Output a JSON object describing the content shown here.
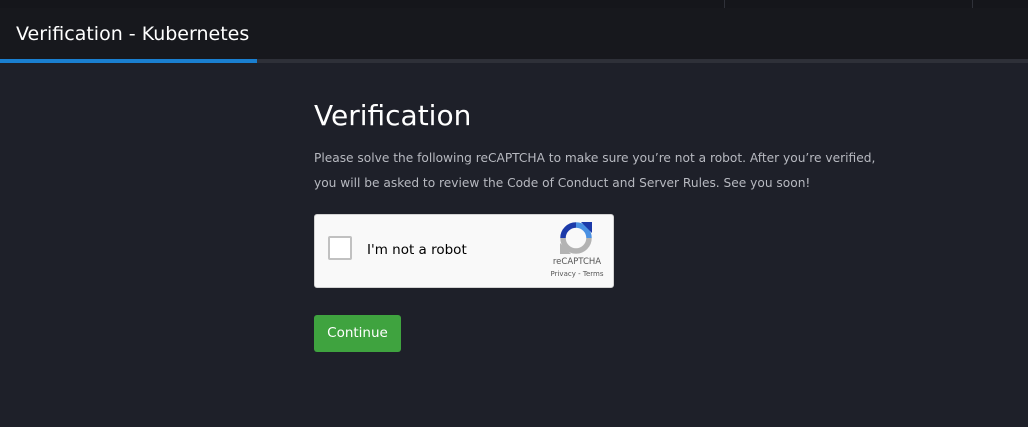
{
  "header": {
    "title": "Verification - Kubernetes",
    "progress_fraction": 0.25
  },
  "main": {
    "title": "Verification",
    "description": "Please solve the following reCAPTCHA to make sure you’re not a robot. After you’re verified, you will be asked to review the Code of Conduct and Server Rules. See you soon!",
    "continue_label": "Continue"
  },
  "recaptcha": {
    "checkbox_label": "I'm not a robot",
    "brand": "reCAPTCHA",
    "privacy_label": "Privacy",
    "separator": " - ",
    "terms_label": "Terms",
    "logo_icon": "recaptcha-logo-icon",
    "checked": false
  },
  "colors": {
    "background": "#1e2029",
    "header": "#17181d",
    "accent": "#1a7fd0",
    "continue_button": "#3fa33f"
  }
}
